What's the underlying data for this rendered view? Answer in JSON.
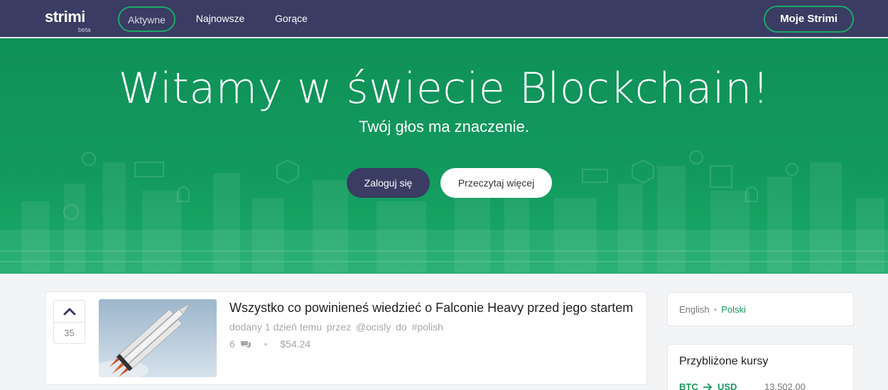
{
  "nav": {
    "logo": "strimi",
    "logo_badge": "beta",
    "tabs": [
      {
        "label": "Aktywne",
        "active": true
      },
      {
        "label": "Najnowsze",
        "active": false
      },
      {
        "label": "Gorące",
        "active": false
      }
    ],
    "my_button": "Moje Strimi"
  },
  "hero": {
    "title": "Witamy w świecie Blockchain!",
    "subtitle": "Twój głos ma znaczenie.",
    "login_button": "Zaloguj się",
    "read_more_button": "Przeczytaj więcej"
  },
  "post": {
    "votes": "35",
    "title": "Wszystko co powinieneś wiedzieć o Falconie Heavy przed jego startem",
    "meta": {
      "added": "dodany 1 dzień temu",
      "by_label": "przez",
      "author": "@ocisly",
      "in_label": "do",
      "tag": "#polish"
    },
    "comments": "6",
    "payout": "$54.24"
  },
  "sidebar": {
    "languages": [
      "English",
      "Polski"
    ],
    "selected_language": "Polski",
    "rates_title": "Przybliżone kursy",
    "rates": [
      {
        "from": "BTC",
        "to": "USD",
        "value": "13,502.00"
      }
    ]
  },
  "colors": {
    "nav_bg": "#3a3c63",
    "brand_green": "#12995d",
    "link_green": "#17995c"
  }
}
